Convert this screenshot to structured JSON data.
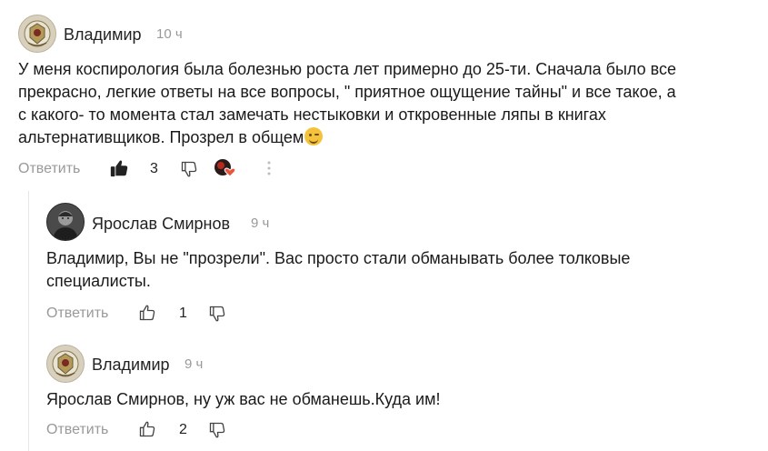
{
  "comments": [
    {
      "author": "Владимир",
      "time": "10 ч",
      "text_lines": [
        "У меня коспирология была болезнью роста лет примерно до 25-ти. Сначала было все",
        "прекрасно, легкие ответы на все вопросы, \" приятное ощущение тайны\" и все такое, а",
        "с какого- то момента стал замечать нестыковки и откровенные ляпы в книгах",
        "альтернативщиков. Прозрел в общем"
      ],
      "emoji": "wink-emoji",
      "reply_label": "Ответить",
      "likes": "3",
      "liked": true,
      "reaction_icon": "author-heart-reaction-icon"
    },
    {
      "author": "Ярослав Смирнов",
      "time": "9 ч",
      "text_lines": [
        "Владимир, Вы не \"прозрели\". Вас просто стали обманывать более толковые",
        "специалисты."
      ],
      "reply_label": "Ответить",
      "likes": "1"
    },
    {
      "author": "Владимир",
      "time": "9 ч",
      "text_lines": [
        "Ярослав Смирнов, ну уж вас не обманешь.Куда им!"
      ],
      "reply_label": "Ответить",
      "likes": "2"
    }
  ],
  "colors": {
    "text": "#1a1a1a",
    "muted": "#999999",
    "thread_line": "#e6e6e6",
    "heart": "#e8553a"
  }
}
